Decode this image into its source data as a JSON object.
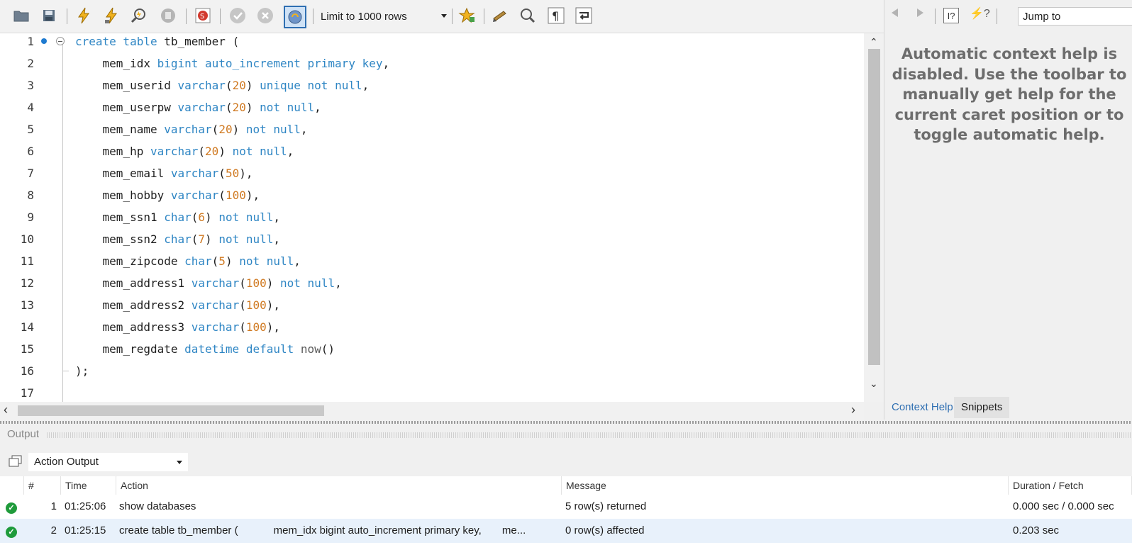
{
  "toolbar": {
    "limit_label": "Limit to 1000 rows"
  },
  "editor": {
    "lines": [
      {
        "n": "1",
        "tokens": [
          [
            "kw",
            "create table "
          ],
          [
            "txt",
            "tb_member ("
          ]
        ]
      },
      {
        "n": "2",
        "tokens": [
          [
            "txt",
            "    mem_idx "
          ],
          [
            "kw",
            "bigint auto_increment primary key"
          ],
          [
            "txt",
            ","
          ]
        ]
      },
      {
        "n": "3",
        "tokens": [
          [
            "txt",
            "    mem_userid "
          ],
          [
            "kw",
            "varchar"
          ],
          [
            "txt",
            "("
          ],
          [
            "num",
            "20"
          ],
          [
            "txt",
            ") "
          ],
          [
            "kw",
            "unique not null"
          ],
          [
            "txt",
            ","
          ]
        ]
      },
      {
        "n": "4",
        "tokens": [
          [
            "txt",
            "    mem_userpw "
          ],
          [
            "kw",
            "varchar"
          ],
          [
            "txt",
            "("
          ],
          [
            "num",
            "20"
          ],
          [
            "txt",
            ") "
          ],
          [
            "kw",
            "not null"
          ],
          [
            "txt",
            ","
          ]
        ]
      },
      {
        "n": "5",
        "tokens": [
          [
            "txt",
            "    mem_name "
          ],
          [
            "kw",
            "varchar"
          ],
          [
            "txt",
            "("
          ],
          [
            "num",
            "20"
          ],
          [
            "txt",
            ") "
          ],
          [
            "kw",
            "not null"
          ],
          [
            "txt",
            ","
          ]
        ]
      },
      {
        "n": "6",
        "tokens": [
          [
            "txt",
            "    mem_hp "
          ],
          [
            "kw",
            "varchar"
          ],
          [
            "txt",
            "("
          ],
          [
            "num",
            "20"
          ],
          [
            "txt",
            ") "
          ],
          [
            "kw",
            "not null"
          ],
          [
            "txt",
            ","
          ]
        ]
      },
      {
        "n": "7",
        "tokens": [
          [
            "txt",
            "    mem_email "
          ],
          [
            "kw",
            "varchar"
          ],
          [
            "txt",
            "("
          ],
          [
            "num",
            "50"
          ],
          [
            "txt",
            "),"
          ]
        ]
      },
      {
        "n": "8",
        "tokens": [
          [
            "txt",
            "    mem_hobby "
          ],
          [
            "kw",
            "varchar"
          ],
          [
            "txt",
            "("
          ],
          [
            "num",
            "100"
          ],
          [
            "txt",
            "),"
          ]
        ]
      },
      {
        "n": "9",
        "tokens": [
          [
            "txt",
            "    mem_ssn1 "
          ],
          [
            "kw",
            "char"
          ],
          [
            "txt",
            "("
          ],
          [
            "num",
            "6"
          ],
          [
            "txt",
            ") "
          ],
          [
            "kw",
            "not null"
          ],
          [
            "txt",
            ","
          ]
        ]
      },
      {
        "n": "10",
        "tokens": [
          [
            "txt",
            "    mem_ssn2 "
          ],
          [
            "kw",
            "char"
          ],
          [
            "txt",
            "("
          ],
          [
            "num",
            "7"
          ],
          [
            "txt",
            ") "
          ],
          [
            "kw",
            "not null"
          ],
          [
            "txt",
            ","
          ]
        ]
      },
      {
        "n": "11",
        "tokens": [
          [
            "txt",
            "    mem_zipcode "
          ],
          [
            "kw",
            "char"
          ],
          [
            "txt",
            "("
          ],
          [
            "num",
            "5"
          ],
          [
            "txt",
            ") "
          ],
          [
            "kw",
            "not null"
          ],
          [
            "txt",
            ","
          ]
        ]
      },
      {
        "n": "12",
        "tokens": [
          [
            "txt",
            "    mem_address1 "
          ],
          [
            "kw",
            "varchar"
          ],
          [
            "txt",
            "("
          ],
          [
            "num",
            "100"
          ],
          [
            "txt",
            ") "
          ],
          [
            "kw",
            "not null"
          ],
          [
            "txt",
            ","
          ]
        ]
      },
      {
        "n": "13",
        "tokens": [
          [
            "txt",
            "    mem_address2 "
          ],
          [
            "kw",
            "varchar"
          ],
          [
            "txt",
            "("
          ],
          [
            "num",
            "100"
          ],
          [
            "txt",
            "),"
          ]
        ]
      },
      {
        "n": "14",
        "tokens": [
          [
            "txt",
            "    mem_address3 "
          ],
          [
            "kw",
            "varchar"
          ],
          [
            "txt",
            "("
          ],
          [
            "num",
            "100"
          ],
          [
            "txt",
            "),"
          ]
        ]
      },
      {
        "n": "15",
        "tokens": [
          [
            "txt",
            "    mem_regdate "
          ],
          [
            "kw",
            "datetime default "
          ],
          [
            "fn",
            "now"
          ],
          [
            "txt",
            "()"
          ]
        ]
      },
      {
        "n": "16",
        "tokens": [
          [
            "txt",
            ");"
          ]
        ]
      },
      {
        "n": "17",
        "tokens": []
      }
    ]
  },
  "right_panel": {
    "jump_label": "Jump to",
    "help_text": "Automatic context help is disabled. Use the toolbar to manually get help for the current caret position or to toggle automatic help.",
    "tabs": [
      "Context Help",
      "Snippets"
    ],
    "active_tab": "Context Help"
  },
  "output": {
    "title": "Output",
    "selector": "Action Output",
    "columns": [
      "#",
      "Time",
      "Action",
      "Message",
      "Duration / Fetch"
    ],
    "rows": [
      {
        "num": "1",
        "time": "01:25:06",
        "action": "show databases",
        "message": "5 row(s) returned",
        "duration": "0.000 sec / 0.000 sec",
        "status": "success"
      },
      {
        "num": "2",
        "time": "01:25:15",
        "action": "create table tb_member (            mem_idx bigint auto_increment primary key,       me...",
        "message": "0 row(s) affected",
        "duration": "0.203 sec",
        "status": "success"
      }
    ]
  },
  "colors": {
    "keyword": "#2f86c4",
    "number": "#d07a22",
    "success": "#1f9b3b",
    "selected_row": "#e8f1fb"
  }
}
